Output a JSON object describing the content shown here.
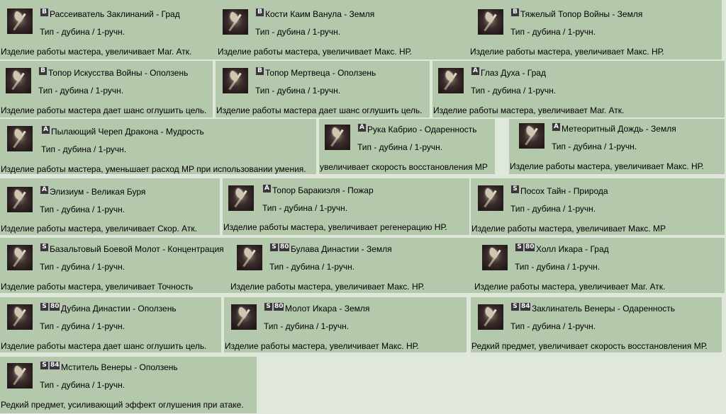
{
  "items": [
    {
      "grade": "B",
      "level": "",
      "name": "Рассеиватель Заклинаний - Град",
      "type": "Тип - дубина / 1-ручн.",
      "desc": "Изделие работы мастера, увеличивает Маг. Атк.",
      "icon": "weapon-icon"
    },
    {
      "grade": "B",
      "level": "",
      "name": "Кости Каим Ванула - Земля",
      "type": "Тип - дубина / 1-ручн.",
      "desc": "Изделие работы мастера, увеличивает Макс. НР.",
      "icon": "weapon-icon"
    },
    {
      "grade": "B",
      "level": "",
      "name": "Тяжелый Топор Войны - Земля",
      "type": "Тип - дубина / 1-ручн.",
      "desc": "Изделие работы мастера, увеличивает Макс. НР.",
      "icon": "weapon-icon"
    },
    {
      "grade": "B",
      "level": "",
      "name": "Топор Искусства Войны - Оползень",
      "type": "Тип - дубина / 1-ручн.",
      "desc": "Изделие работы мастера дает шанс оглушить цель.",
      "icon": "weapon-icon"
    },
    {
      "grade": "B",
      "level": "",
      "name": "Топор Мертвеца - Оползень",
      "type": "Тип - дубина / 1-ручн.",
      "desc": "Изделие работы мастера дает шанс оглушить цель.",
      "icon": "weapon-icon"
    },
    {
      "grade": "A",
      "level": "",
      "name": "Глаз Духа - Град",
      "type": "Тип - дубина / 1-ручн.",
      "desc": "Изделие работы мастера, увеличивает Маг. Атк.",
      "icon": "weapon-icon"
    },
    {
      "grade": "A",
      "level": "",
      "name": "Пылающий Череп Дракона - Мудрость",
      "type": "Тип - дубина / 1-ручн.",
      "desc": "Изделие работы мастера, уменьшает расход МР при использовании умения.",
      "icon": "weapon-icon"
    },
    {
      "grade": "A",
      "level": "",
      "name": "Рука Кабрио - Одаренность",
      "type": "Тип - дубина / 1-ручн.",
      "desc": "увеличивает скорость восстановления МР",
      "icon": "weapon-icon"
    },
    {
      "grade": "A",
      "level": "",
      "name": "Метеоритный Дождь - Земля",
      "type": "Тип - дубина / 1-ручн.",
      "desc": "Изделие работы мастера, увеличивает Макс. НР.",
      "icon": "weapon-icon"
    },
    {
      "grade": "A",
      "level": "",
      "name": "Элизиум - Великая Буря",
      "type": "Тип - дубина / 1-ручн.",
      "desc": "Изделие работы мастера, увеличивает Скор. Атк.",
      "icon": "weapon-icon"
    },
    {
      "grade": "A",
      "level": "",
      "name": "Топор Баракиэля - Пожар",
      "type": "Тип - дубина / 1-ручн.",
      "desc": "Изделие работы мастера, увеличивает регенерацию НР.",
      "icon": "weapon-icon"
    },
    {
      "grade": "S",
      "level": "",
      "name": "Посох Тайн - Природа",
      "type": "Тип - дубина / 1-ручн.",
      "desc": "Изделие работы мастера, увеличивает Макс. МР",
      "icon": "weapon-icon"
    },
    {
      "grade": "S",
      "level": "",
      "name": "Базальтовый Боевой Молот - Концентрация",
      "type": "Тип - дубина / 1-ручн.",
      "desc": "Изделие работы мастера, увеличивает Точность",
      "icon": "weapon-icon"
    },
    {
      "grade": "S",
      "level": "80",
      "name": "Булава Династии - Земля",
      "type": "Тип - дубина / 1-ручн.",
      "desc": "Изделие работы мастера, увеличивает Макс. НР.",
      "icon": "weapon-icon"
    },
    {
      "grade": "S",
      "level": "80",
      "name": "Холл Икара - Град",
      "type": "Тип - дубина / 1-ручн.",
      "desc": "Изделие работы мастера, увеличивает Маг. Атк.",
      "icon": "weapon-icon"
    },
    {
      "grade": "S",
      "level": "80",
      "name": "Дубина Династии - Оползень",
      "type": "Тип - дубина / 1-ручн.",
      "desc": "Изделие работы мастера дает шанс оглушить цель.",
      "icon": "weapon-icon"
    },
    {
      "grade": "S",
      "level": "80",
      "name": "Молот Икара - Земля",
      "type": "Тип - дубина / 1-ручн.",
      "desc": "Изделие работы мастера, увеличивает Макс. НР.",
      "icon": "weapon-icon"
    },
    {
      "grade": "S",
      "level": "84",
      "name": "Заклинатель Венеры - Одаренность",
      "type": "Тип - дубина / 1-ручн.",
      "desc": "Редкий предмет, увеличивает скорость восстановления МР.",
      "icon": "weapon-icon"
    },
    {
      "grade": "S",
      "level": "84",
      "name": "Мститель Венеры - Оползень",
      "type": "Тип - дубина / 1-ручн.",
      "desc": "Редкий предмет, усиливающий эффект оглушения при атаке.",
      "icon": "weapon-icon"
    }
  ],
  "colors": {
    "page_bg": "#dfe8da",
    "card_bg": "#b4c8ac"
  }
}
